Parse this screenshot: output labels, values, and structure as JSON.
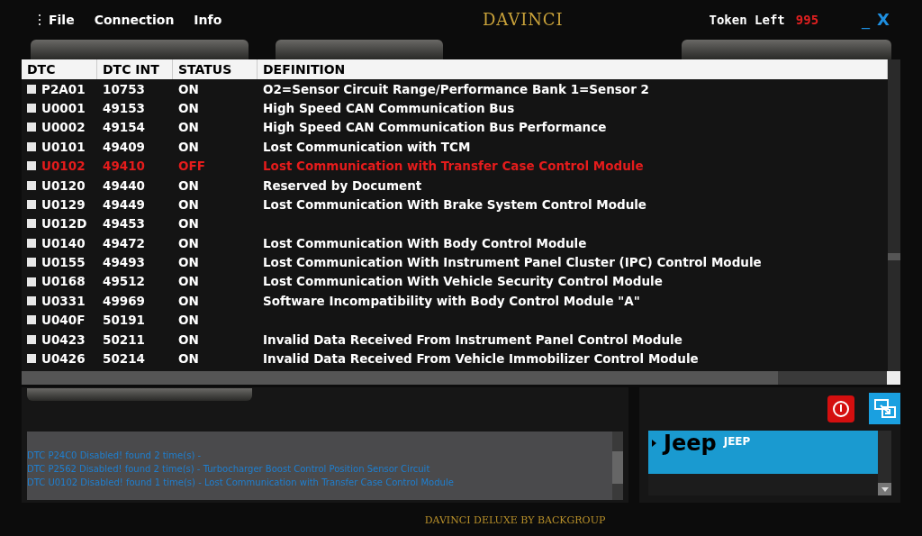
{
  "menu": [
    "File",
    "Connection",
    "Info"
  ],
  "window": {
    "title": "DAVINCI",
    "token_label": "Token Left",
    "token_value": "995",
    "minimize": "_",
    "close": "X"
  },
  "table": {
    "columns": [
      "DTC",
      "DTC INT",
      "STATUS",
      "DEFINITION"
    ],
    "rows": [
      {
        "dtc": "P2A01",
        "int": "10753",
        "status": "ON",
        "definition": "O2=Sensor Circuit Range/Performance Bank 1=Sensor 2",
        "checked": false,
        "disabled": false
      },
      {
        "dtc": "U0001",
        "int": "49153",
        "status": "ON",
        "definition": "High Speed CAN Communication Bus",
        "checked": false,
        "disabled": false
      },
      {
        "dtc": "U0002",
        "int": "49154",
        "status": "ON",
        "definition": "High Speed CAN Communication Bus Performance",
        "checked": false,
        "disabled": false
      },
      {
        "dtc": "U0101",
        "int": "49409",
        "status": "ON",
        "definition": "Lost Communication with TCM",
        "checked": false,
        "disabled": false
      },
      {
        "dtc": "U0102",
        "int": "49410",
        "status": "OFF",
        "definition": "Lost Communication with Transfer Case Control Module",
        "checked": false,
        "disabled": true
      },
      {
        "dtc": "U0120",
        "int": "49440",
        "status": "ON",
        "definition": "Reserved by Document",
        "checked": false,
        "disabled": false
      },
      {
        "dtc": "U0129",
        "int": "49449",
        "status": "ON",
        "definition": "Lost Communication With Brake System Control Module",
        "checked": false,
        "disabled": false
      },
      {
        "dtc": "U012D",
        "int": "49453",
        "status": "ON",
        "checked": false,
        "disabled": false
      },
      {
        "dtc": "U0140",
        "int": "49472",
        "status": "ON",
        "definition": "Lost Communication With Body Control Module",
        "checked": false,
        "disabled": false
      },
      {
        "dtc": "U0155",
        "int": "49493",
        "status": "ON",
        "definition": "Lost Communication With Instrument Panel Cluster (IPC) Control Module",
        "checked": false,
        "disabled": false
      },
      {
        "dtc": "U0168",
        "int": "49512",
        "status": "ON",
        "definition": "Lost Communication With Vehicle Security Control Module",
        "checked": false,
        "disabled": false
      },
      {
        "dtc": "U0331",
        "int": "49969",
        "status": "ON",
        "definition": "Software Incompatibility with Body Control Module \"A\"",
        "checked": false,
        "disabled": false
      },
      {
        "dtc": "U040F",
        "int": "50191",
        "status": "ON",
        "checked": false,
        "disabled": false
      },
      {
        "dtc": "U0423",
        "int": "50211",
        "status": "ON",
        "definition": "Invalid Data Received From Instrument Panel Control Module",
        "checked": false,
        "disabled": false
      },
      {
        "dtc": "U0426",
        "int": "50214",
        "status": "ON",
        "definition": "Invalid Data Received From Vehicle Immobilizer Control Module",
        "checked": false,
        "disabled": false
      }
    ]
  },
  "log": [
    "DTC P24C0 Disabled! found 2 time(s) -",
    "DTC P2562 Disabled! found 2 time(s) - Turbocharger Boost Control Position Sensor Circuit",
    "DTC U0102 Disabled! found 1 time(s) - Lost Communication with Transfer Case Control Module"
  ],
  "vehicles": [
    {
      "logo": "Jeep",
      "name": "JEEP",
      "selected": true
    }
  ],
  "footer": "DAVINCI DELUXE BY BACKGROUP"
}
